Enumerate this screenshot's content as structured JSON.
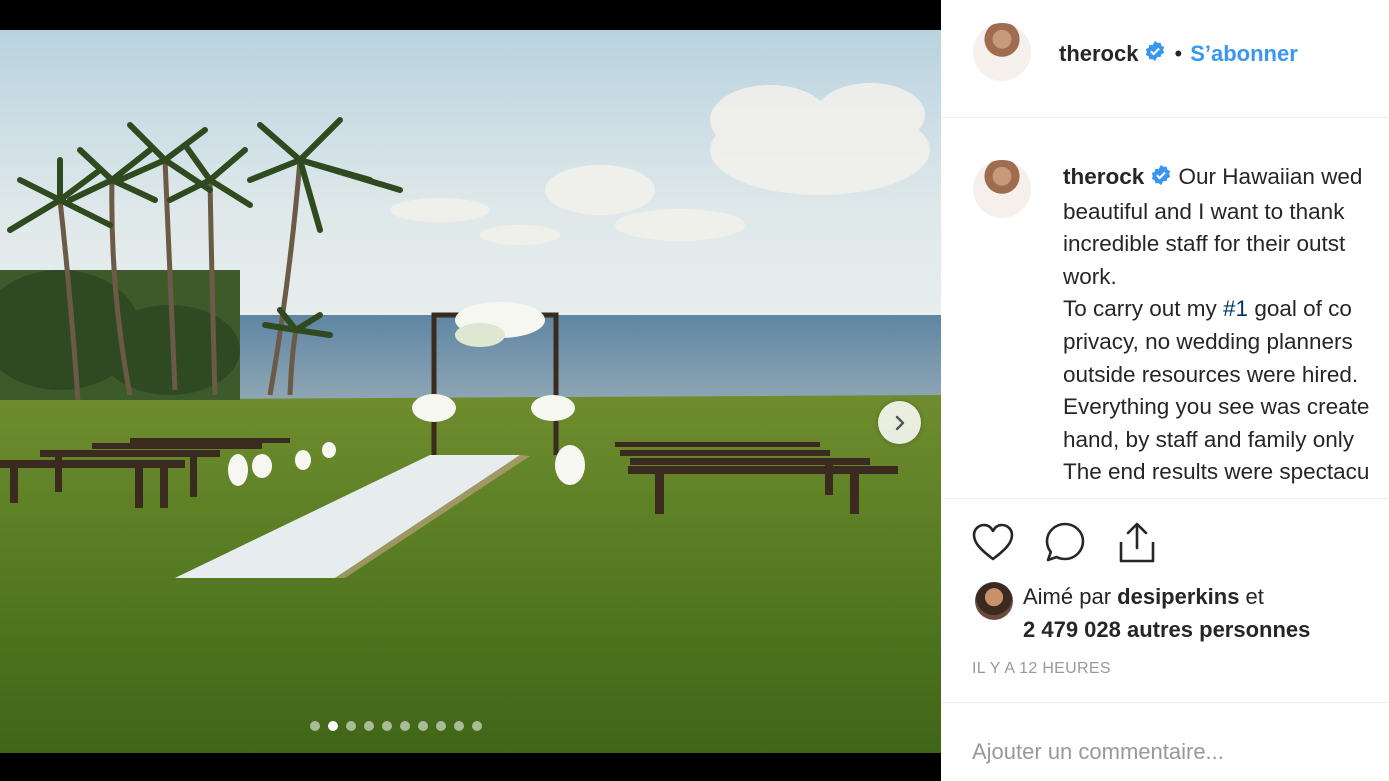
{
  "post": {
    "username": "therock",
    "separator": "•",
    "follow_label": "S’abonner",
    "caption": {
      "username": "therock",
      "line1": "Our Hawaiian wed",
      "line2": "beautiful and I want to thank",
      "line3": "incredible staff for their outst",
      "line4": "work.",
      "line5_pre": "To carry out my ",
      "hashtag": "#1",
      "line5_post": " goal of co",
      "line6": "privacy, no wedding planners",
      "line7": "outside resources were hired.",
      "line8": "Everything you see was create",
      "line9": "hand, by staff and family only",
      "line10": "The end results were spectacu"
    },
    "likes": {
      "prefix": "Aimé par ",
      "liker": "desiperkins",
      "mid": " et",
      "others": "2 479 028 autres personnes"
    },
    "timestamp": "IL Y A 12 HEURES",
    "comment_placeholder": "Ajouter un commentaire...",
    "carousel": {
      "count": 10,
      "active_index": 1
    }
  },
  "icons": {
    "verified": "verified-badge-icon",
    "like": "heart-icon",
    "comment": "comment-bubble-icon",
    "share": "share-icon",
    "next": "chevron-right-icon"
  },
  "colors": {
    "accent": "#3897f0",
    "hashtag": "#003569",
    "text": "#262626",
    "muted": "#999999"
  }
}
